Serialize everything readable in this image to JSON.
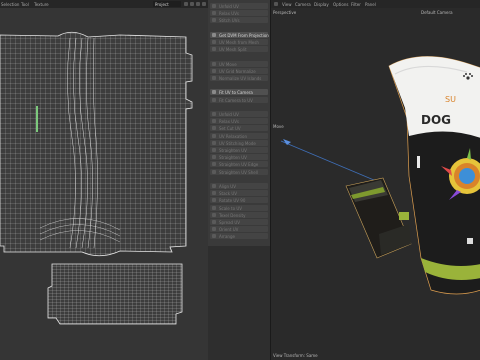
{
  "uv_editor": {
    "menu": [
      "Selection",
      "Tool",
      "Texture"
    ],
    "mode_select": "Project"
  },
  "tool_panel": {
    "items": [
      {
        "label": "Unfold UV",
        "active": false
      },
      {
        "label": "Relax UVs",
        "active": false
      },
      {
        "label": "Stitch UVs",
        "active": false
      },
      {
        "label": "",
        "active": false
      },
      {
        "label": "Get DVM From Projection",
        "active": true
      },
      {
        "label": "UV Mesh from Mesh",
        "active": false
      },
      {
        "label": "UV Mesh Split",
        "active": false
      },
      {
        "label": "",
        "active": false
      },
      {
        "label": "UV Move",
        "active": false
      },
      {
        "label": "UV Grid Normalize",
        "active": false
      },
      {
        "label": "Normalize UV Islands",
        "active": false
      },
      {
        "label": "",
        "active": false
      },
      {
        "label": "Fit UV to Camera",
        "active": true
      },
      {
        "label": "Fit Camera to UV",
        "active": false
      },
      {
        "label": "",
        "active": false
      },
      {
        "label": "Unfold UV",
        "active": false
      },
      {
        "label": "Relax UVs",
        "active": false
      },
      {
        "label": "Set Cut UV",
        "active": false
      },
      {
        "label": "UV Relaxation",
        "active": false
      },
      {
        "label": "UV Stitching Mode",
        "active": false
      },
      {
        "label": "Straighten UV",
        "active": false
      },
      {
        "label": "Straighten UV",
        "active": false
      },
      {
        "label": "Straighten UV Edge",
        "active": false
      },
      {
        "label": "Straighten UV Shell",
        "active": false
      },
      {
        "label": "",
        "active": false
      },
      {
        "label": "Align UV",
        "active": false
      },
      {
        "label": "Stack UV",
        "active": false
      },
      {
        "label": "Rotate UV 90",
        "active": false
      },
      {
        "label": "Scale to UV",
        "active": false
      },
      {
        "label": "Texel Density",
        "active": false
      },
      {
        "label": "Spread UV",
        "active": false
      },
      {
        "label": "Orient UV",
        "active": false
      },
      {
        "label": "Arrange",
        "active": false
      }
    ]
  },
  "viewport": {
    "menu": [
      "View",
      "Camera",
      "Display",
      "Options",
      "Filter",
      "Panel"
    ],
    "camera_label": "Default Camera",
    "perspective_label": "Perspective",
    "move_label": "Move",
    "status_label": "View Transform: Same"
  },
  "product": {
    "brand_line1": "SU",
    "brand_line2": "DOG",
    "colors": {
      "bag_top": "#f2f2f0",
      "bag_body": "#1c1c1c",
      "accent_green": "#9ab33a",
      "accent_orange": "#d9832a",
      "accent_yellow": "#e6c43a",
      "accent_blue": "#3d8fd8",
      "selection_outline": "#e0a050"
    }
  }
}
